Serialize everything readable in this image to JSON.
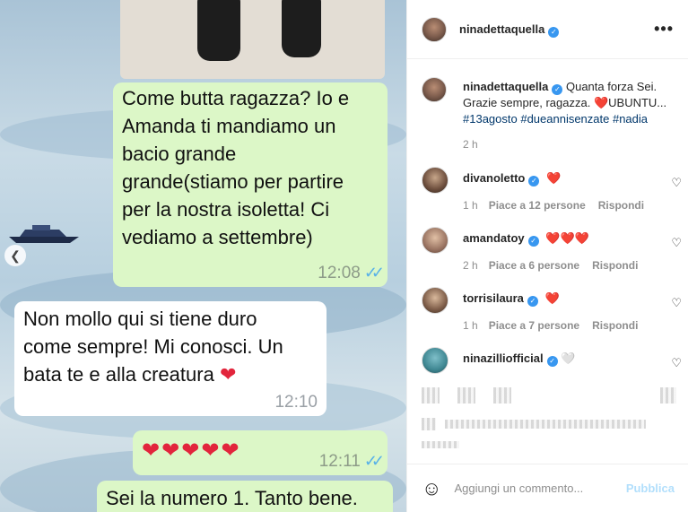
{
  "photo": {
    "bubble1": {
      "lines": [
        "Come butta ragazza? Io e",
        "Amanda ti mandiamo un",
        "bacio grande",
        "grande(stiamo per partire",
        "per la nostra isoletta! Ci",
        "vediamo a settembre)"
      ],
      "time": "12:08"
    },
    "bubble2": {
      "lines": [
        "Non mollo qui si tiene duro",
        "come sempre! Mi conosci. Un",
        "bata te e alla creatura"
      ],
      "time": "12:10"
    },
    "bubble3": {
      "hearts": "❤️❤️❤️❤️❤️",
      "time": "12:11"
    },
    "bubble4": {
      "text": "Sei la numero 1. Tanto bene."
    }
  },
  "post": {
    "author": "ninadettaquella",
    "more_icon": "more-horizontal-icon",
    "caption_text": "Quanta forza Sei. Grazie sempre, ragazza. ❤️UBUNTU...",
    "hashtags": "#13agosto #dueannisenzate #nadia",
    "caption_time": "2 h"
  },
  "comments": [
    {
      "user": "divanoletto",
      "text": "❤️",
      "time": "1 h",
      "likes": "Piace a 12 persone",
      "reply": "Rispondi"
    },
    {
      "user": "amandatoy",
      "text": "❤️❤️❤️",
      "time": "2 h",
      "likes": "Piace a 6 persone",
      "reply": "Rispondi"
    },
    {
      "user": "torrisilaura",
      "text": "❤️",
      "time": "1 h",
      "likes": "Piace a 7 persone",
      "reply": "Rispondi"
    },
    {
      "user": "ninazilliofficial",
      "text": "🤍",
      "time": "",
      "likes": "",
      "reply": ""
    }
  ],
  "compose": {
    "placeholder": "Aggiungi un commento...",
    "post_label": "Pubblica"
  },
  "colors": {
    "link": "#00376b",
    "verified": "#3897f0",
    "heart": "#e2253c",
    "post_disabled": "#b2dffc",
    "bubble_out": "#dcf7c7"
  }
}
